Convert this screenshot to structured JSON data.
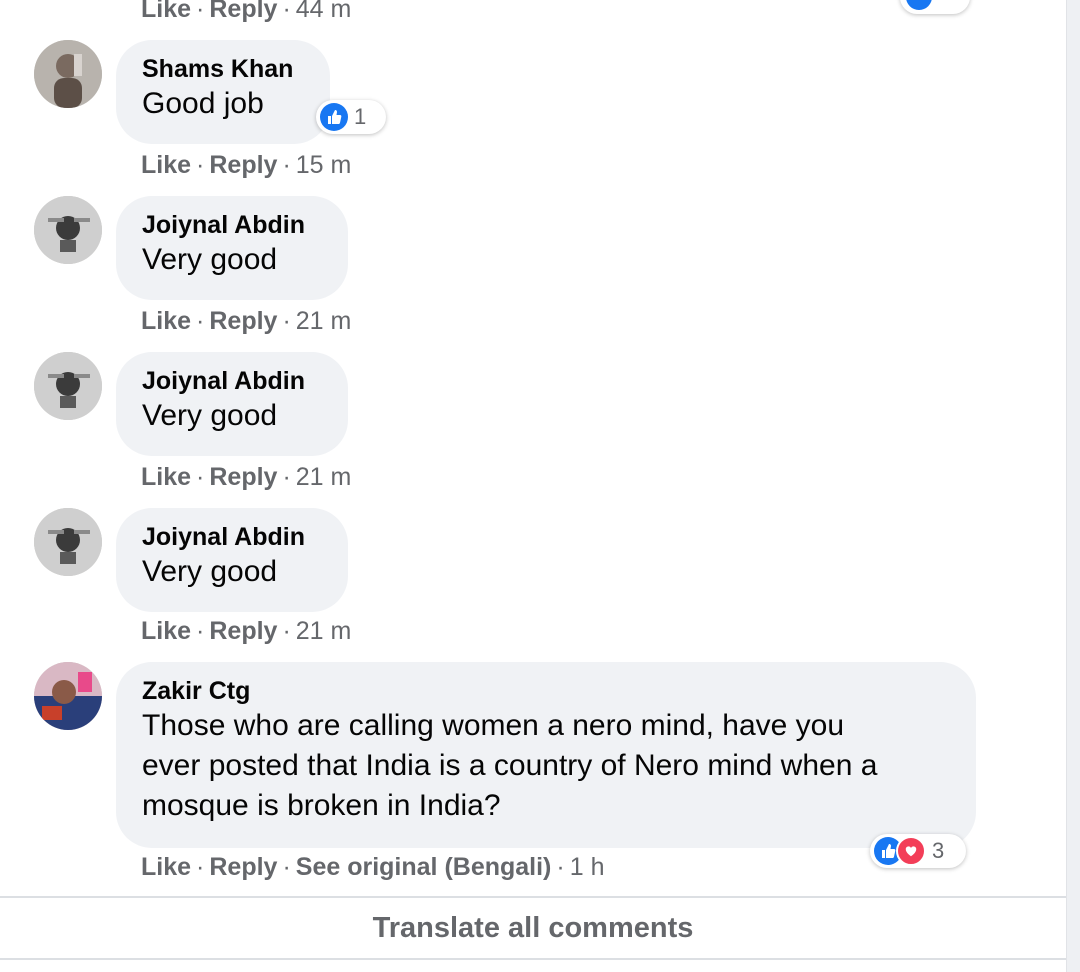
{
  "top_partial": {
    "actions": {
      "like": "Like",
      "reply": "Reply",
      "time": "44 m"
    }
  },
  "comments": [
    {
      "author": "Shams Khan",
      "text": "Good job",
      "reactions": {
        "count": "1",
        "types": [
          "like"
        ]
      },
      "actions": {
        "like": "Like",
        "reply": "Reply",
        "time": "15 m"
      }
    },
    {
      "author": "Joiynal Abdin",
      "text": "Very good",
      "actions": {
        "like": "Like",
        "reply": "Reply",
        "time": "21 m"
      }
    },
    {
      "author": "Joiynal Abdin",
      "text": "Very good",
      "actions": {
        "like": "Like",
        "reply": "Reply",
        "time": "21 m"
      }
    },
    {
      "author": "Joiynal Abdin",
      "text": "Very good",
      "actions": {
        "like": "Like",
        "reply": "Reply",
        "time": "21 m"
      }
    },
    {
      "author": "Zakir Ctg",
      "text_lines": [
        "Those who are calling women a nero mind, have you",
        "ever posted that India is a country of Nero mind when a",
        "mosque is broken in India?"
      ],
      "reactions": {
        "count": "3",
        "types": [
          "like",
          "love"
        ]
      },
      "actions": {
        "like": "Like",
        "reply": "Reply",
        "see_original": "See original (Bengali)",
        "time": "1 h"
      }
    }
  ],
  "translate_all": "Translate all comments",
  "colors": {
    "bubble": "#f0f2f5",
    "secondary_text": "#65676b",
    "like_blue": "#1877f2",
    "love_red": "#f33e58"
  }
}
